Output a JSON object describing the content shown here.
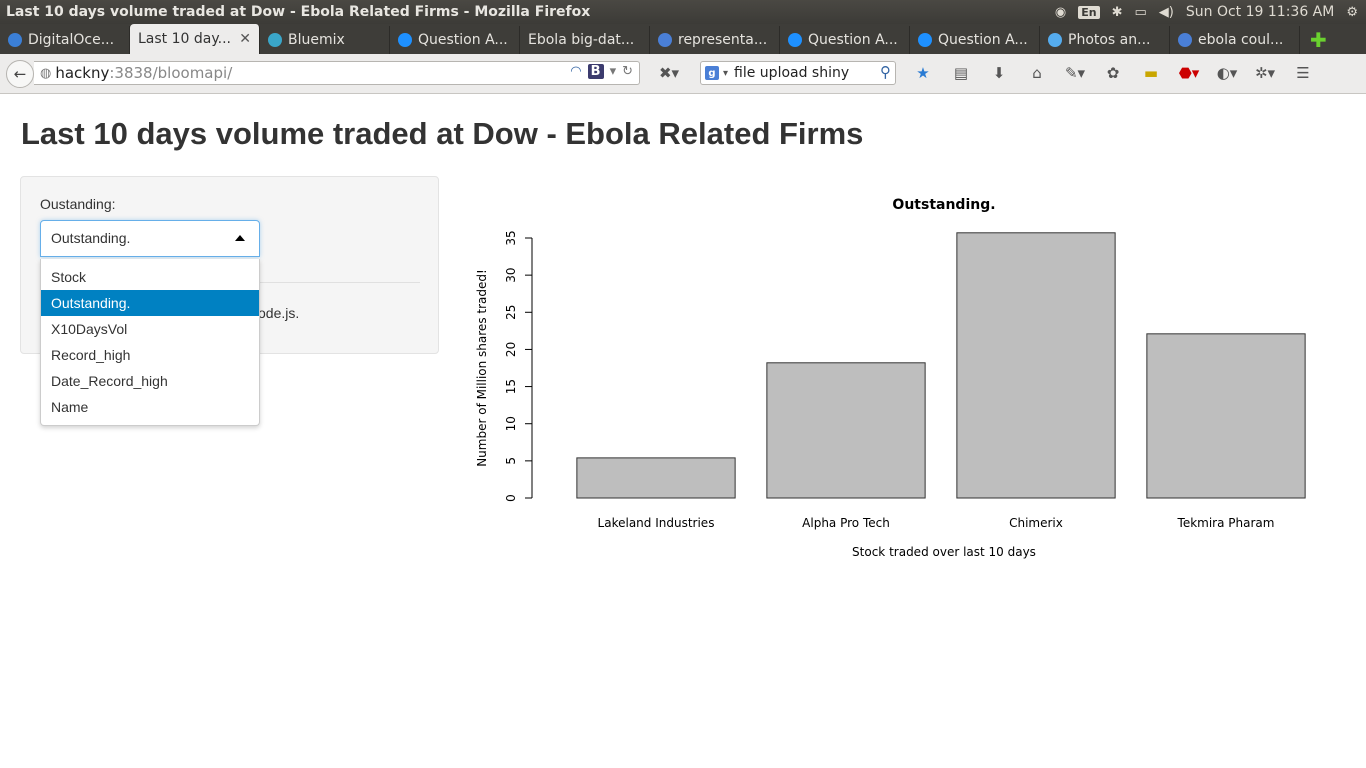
{
  "window": {
    "title": "Last 10 days volume traded at Dow - Ebola Related Firms - Mozilla Firefox"
  },
  "panel": {
    "lang": "En",
    "datetime": "Sun Oct 19 11:36 AM"
  },
  "tabs": [
    {
      "label": "DigitalOce...",
      "color": "#3b7fd6",
      "active": false
    },
    {
      "label": "Last 10 day...",
      "color": "",
      "active": true
    },
    {
      "label": "Bluemix",
      "color": "#3aa6c9",
      "active": false
    },
    {
      "label": "Question A...",
      "color": "#1e90ff",
      "active": false
    },
    {
      "label": "Ebola big-dat...",
      "color": "",
      "active": false
    },
    {
      "label": "representa...",
      "color": "#4a7fd6",
      "active": false
    },
    {
      "label": "Question A...",
      "color": "#1e90ff",
      "active": false
    },
    {
      "label": "Question A...",
      "color": "#1e90ff",
      "active": false
    },
    {
      "label": "Photos an...",
      "color": "#55acee",
      "active": false
    },
    {
      "label": "ebola coul...",
      "color": "#4a7fd6",
      "active": false
    }
  ],
  "nav": {
    "url_host": "hackny",
    "url_rest": ":3838/bloomapi/",
    "search_value": "file upload shiny"
  },
  "page": {
    "title": "Last 10 days volume traded at Dow - Ebola Related Firms",
    "select_label": "Oustanding:",
    "selected": "Outstanding.",
    "options": [
      "Stock",
      "Outstanding.",
      "X10DaysVol",
      "Record_high",
      "Date_Record_high",
      "Name"
    ],
    "hidden_text": "ode.js."
  },
  "chart_data": {
    "type": "bar",
    "title": "Outstanding.",
    "xlabel": "Stock traded over last 10 days",
    "ylabel": "Number of Million shares traded!",
    "categories": [
      "Lakeland Industries",
      "Alpha Pro Tech",
      "Chimerix",
      "Tekmira Pharam"
    ],
    "values": [
      5.4,
      18.2,
      35.7,
      22.1
    ],
    "ylim": [
      0,
      35
    ],
    "yticks": [
      0,
      5,
      10,
      15,
      20,
      25,
      30,
      35
    ],
    "bar_color": "#bebebe",
    "grid": false
  }
}
